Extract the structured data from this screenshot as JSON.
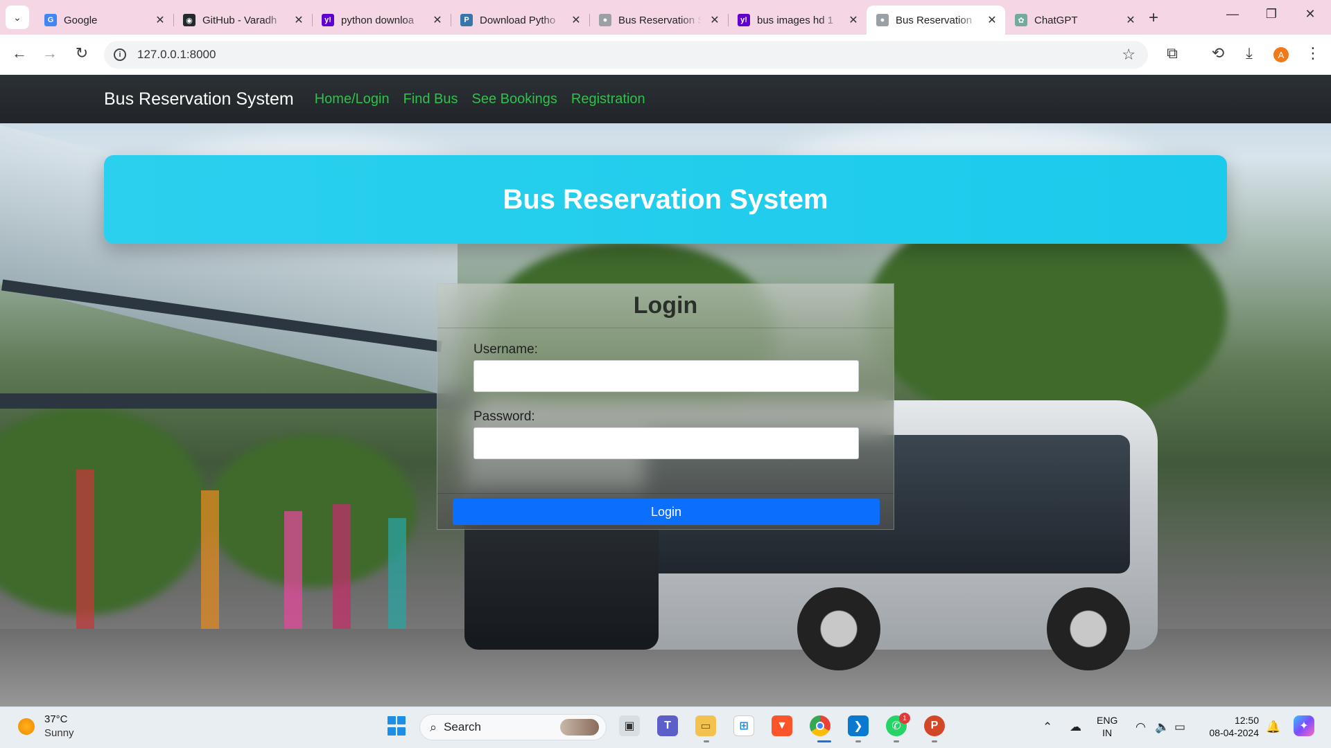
{
  "browser": {
    "tabs": [
      {
        "title": "Google",
        "favicon": "google-icon",
        "color": "#4285f4",
        "glyph": "G"
      },
      {
        "title": "GitHub - Varadh",
        "favicon": "github-icon",
        "color": "#24292f",
        "glyph": "◉"
      },
      {
        "title": "python downloa",
        "favicon": "yahoo-icon",
        "color": "#6001d2",
        "glyph": "y!"
      },
      {
        "title": "Download Pytho",
        "favicon": "python-icon",
        "color": "#3776ab",
        "glyph": "P"
      },
      {
        "title": "Bus Reservation S",
        "favicon": "globe-icon",
        "color": "#9aa0a6",
        "glyph": "●"
      },
      {
        "title": "bus images hd 1",
        "favicon": "yahoo-icon",
        "color": "#6001d2",
        "glyph": "y!"
      },
      {
        "title": "Bus Reservation",
        "favicon": "globe-icon",
        "color": "#9aa0a6",
        "glyph": "●",
        "active": true
      },
      {
        "title": "ChatGPT",
        "favicon": "chatgpt-icon",
        "color": "#74aa9c",
        "glyph": "✿"
      }
    ],
    "url": "127.0.0.1:8000",
    "profile_initial": "A"
  },
  "nav": {
    "brand": "Bus Reservation System",
    "links": [
      "Home/Login",
      "Find Bus",
      "See Bookings",
      "Registration"
    ],
    "link_color": "#2ec24a"
  },
  "hero": {
    "title": "Bus Reservation System"
  },
  "login": {
    "title": "Login",
    "username_label": "Username:",
    "username_value": "",
    "password_label": "Password:",
    "password_value": "",
    "button_label": "Login",
    "button_color": "#0b6efd"
  },
  "taskbar": {
    "weather_temp": "37°C",
    "weather_desc": "Sunny",
    "search_label": "Search",
    "whatsapp_badge": "1",
    "language": "ENG",
    "region": "IN",
    "time": "12:50",
    "date": "08-04-2024"
  }
}
